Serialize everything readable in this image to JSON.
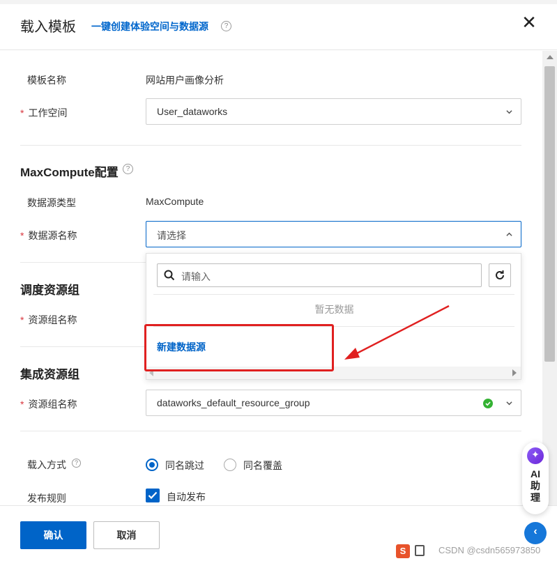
{
  "header": {
    "title": "载入模板",
    "subtitle": "一键创建体验空间与数据源",
    "help_icon": "?",
    "close_icon": "✕"
  },
  "form": {
    "template_name_label": "模板名称",
    "template_name_value": "网站用户画像分析",
    "workspace_label": "工作空间",
    "workspace_value": "User_dataworks",
    "required_mark": "*"
  },
  "maxcompute": {
    "section_title": "MaxCompute配置",
    "ds_type_label": "数据源类型",
    "ds_type_value": "MaxCompute",
    "ds_name_label": "数据源名称",
    "ds_name_placeholder": "请选择"
  },
  "dropdown": {
    "search_placeholder": "请输入",
    "empty_text": "暂无数据",
    "new_datasource_link": "新建数据源"
  },
  "schedule": {
    "section_title": "调度资源组",
    "group_label": "资源组名称"
  },
  "integration": {
    "section_title": "集成资源组",
    "group_label": "资源组名称",
    "group_value": "dataworks_default_resource_group"
  },
  "load": {
    "mode_label": "载入方式",
    "options": [
      {
        "label": "同名跳过",
        "checked": true
      },
      {
        "label": "同名覆盖",
        "checked": false
      }
    ],
    "publish_label": "发布规则",
    "auto_publish": "自动发布"
  },
  "footer": {
    "confirm": "确认",
    "cancel": "取消"
  },
  "ai_assistant": {
    "logo": "✦",
    "line1": "AI",
    "line2": "助",
    "line3": "理"
  },
  "collapse_icon": "‹",
  "watermark": {
    "logo": "S",
    "text": "CSDN @csdn565973850"
  },
  "colors": {
    "accent": "#0064c8",
    "success": "#34b233",
    "required": "#d9363e",
    "annotation": "#e02020"
  }
}
